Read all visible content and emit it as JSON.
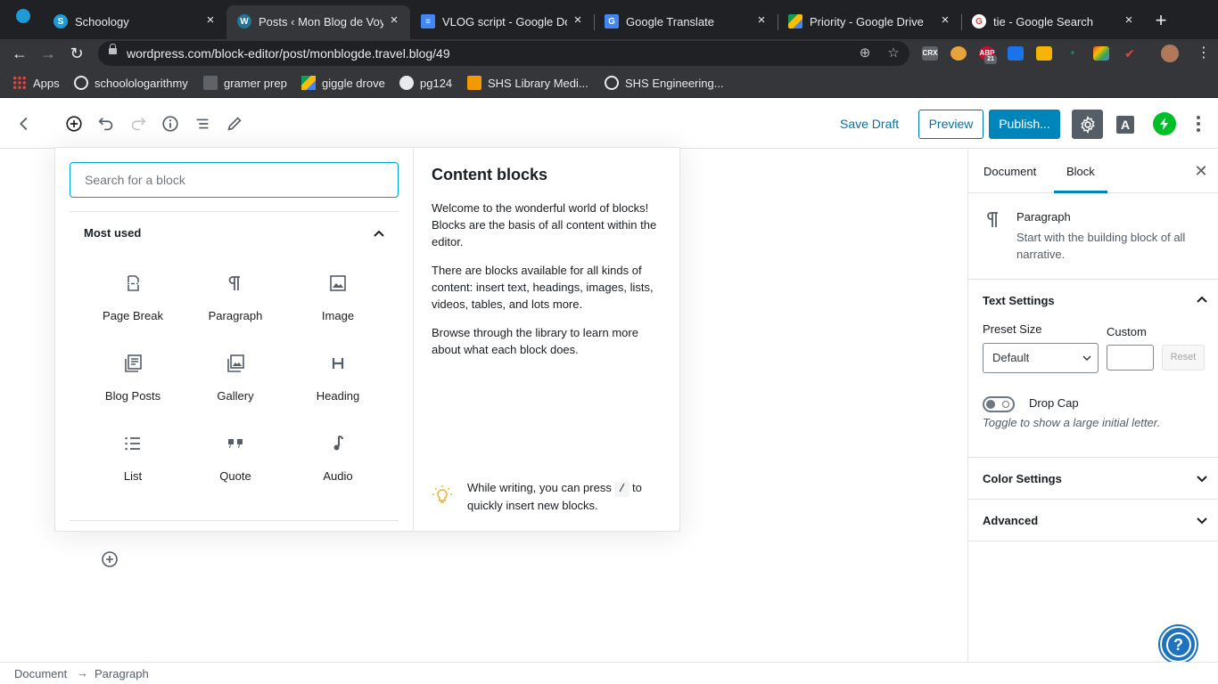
{
  "browser": {
    "tabs": [
      {
        "label": "Schoology",
        "icon": "schoology-icon",
        "color": "#1d9bd7",
        "active": false
      },
      {
        "label": "Posts ‹ Mon Blog de Voyage",
        "icon": "wordpress-icon",
        "color": "#21759b",
        "active": true
      },
      {
        "label": "VLOG script - Google Docs",
        "icon": "google-docs-icon",
        "color": "#4285f4",
        "active": false
      },
      {
        "label": "Google Translate",
        "icon": "google-translate-icon",
        "color": "#4285f4",
        "active": false
      },
      {
        "label": "Priority - Google Drive",
        "icon": "google-drive-icon",
        "color": "#fbbc04",
        "active": false
      },
      {
        "label": "tie - Google Search",
        "icon": "google-icon",
        "color": "#ea4335",
        "active": false
      }
    ],
    "url": "wordpress.com/block-editor/post/monblogde.travel.blog/49",
    "extensions": [
      "CRX",
      "ABP",
      "21"
    ],
    "bookmarks": [
      {
        "label": "Apps",
        "icon": "apps-grid-icon"
      },
      {
        "label": "schoolologarithmy",
        "icon": "schoology-icon"
      },
      {
        "label": "gramer prep",
        "icon": "gb-icon"
      },
      {
        "label": "giggle drove",
        "icon": "google-drive-icon"
      },
      {
        "label": "pg124",
        "icon": "globe-icon"
      },
      {
        "label": "SHS Library Medi...",
        "icon": "library-icon"
      },
      {
        "label": "SHS Engineering...",
        "icon": "schoology-icon"
      }
    ]
  },
  "editor": {
    "header": {
      "save_draft": "Save Draft",
      "preview": "Preview",
      "publish": "Publish...",
      "font_badge": "A"
    },
    "inserter": {
      "search_placeholder": "Search for a block",
      "section_title": "Most used",
      "blocks": [
        {
          "label": "Page Break",
          "icon": "page-break-icon"
        },
        {
          "label": "Paragraph",
          "icon": "paragraph-icon"
        },
        {
          "label": "Image",
          "icon": "image-icon"
        },
        {
          "label": "Blog Posts",
          "icon": "blog-posts-icon"
        },
        {
          "label": "Gallery",
          "icon": "gallery-icon"
        },
        {
          "label": "Heading",
          "icon": "heading-icon"
        },
        {
          "label": "List",
          "icon": "list-icon"
        },
        {
          "label": "Quote",
          "icon": "quote-icon"
        },
        {
          "label": "Audio",
          "icon": "audio-icon"
        }
      ],
      "help": {
        "title": "Content blocks",
        "para1": "Welcome to the wonderful world of blocks! Blocks are the basis of all content within the editor.",
        "para2": "There are blocks available for all kinds of content: insert text, headings, images, lists, videos, tables, and lots more.",
        "para3": "Browse through the library to learn more about what each block does.",
        "tip_before": "While writing, you can press",
        "tip_key": "/",
        "tip_after": "to quickly insert new blocks."
      }
    },
    "sidebar": {
      "tab_document": "Document",
      "tab_block": "Block",
      "block_name": "Paragraph",
      "block_desc": "Start with the building block of all narrative.",
      "text_settings": "Text Settings",
      "preset_label": "Preset Size",
      "custom_label": "Custom",
      "preset_value": "Default",
      "reset": "Reset",
      "drop_cap": "Drop Cap",
      "drop_cap_help": "Toggle to show a large initial letter.",
      "color_settings": "Color Settings",
      "advanced": "Advanced"
    },
    "footer": {
      "crumb_document": "Document",
      "crumb_arrow": "→",
      "crumb_paragraph": "Paragraph"
    },
    "colors": {
      "accent": "#0085ba",
      "link": "#0073aa",
      "help": "#1e73be",
      "jetpack": "#00be28"
    }
  }
}
